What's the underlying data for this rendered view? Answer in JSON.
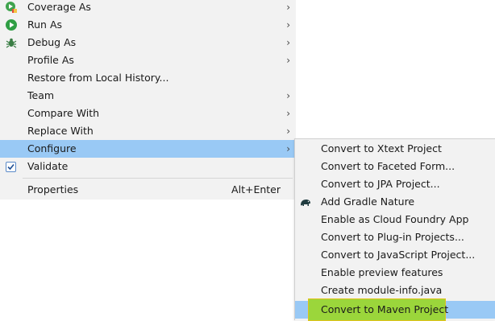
{
  "main_menu": {
    "items": [
      {
        "label": "Coverage As",
        "arrow": "›"
      },
      {
        "label": "Run As",
        "arrow": "›"
      },
      {
        "label": "Debug As",
        "arrow": "›"
      },
      {
        "label": "Profile As",
        "arrow": "›"
      },
      {
        "label": "Restore from Local History..."
      },
      {
        "label": "Team",
        "arrow": "›"
      },
      {
        "label": "Compare With",
        "arrow": "›"
      },
      {
        "label": "Replace With",
        "arrow": "›"
      },
      {
        "label": "Configure",
        "arrow": "›",
        "highlighted": true
      },
      {
        "label": "Validate",
        "checked": true
      },
      {
        "label": "Properties",
        "shortcut": "Alt+Enter"
      }
    ]
  },
  "sub_menu": {
    "items": [
      {
        "label": "Convert to Xtext Project"
      },
      {
        "label": "Convert to Faceted Form..."
      },
      {
        "label": "Convert to JPA Project..."
      },
      {
        "label": "Add Gradle Nature",
        "icon": "gradle-elephant-icon"
      },
      {
        "label": "Enable as Cloud Foundry App"
      },
      {
        "label": "Convert to Plug-in Projects..."
      },
      {
        "label": "Convert to JavaScript Project..."
      },
      {
        "label": "Enable preview features"
      },
      {
        "label": "Create module-info.java"
      },
      {
        "label": "Convert to Maven Project",
        "highlighted": true,
        "focus_box": true
      }
    ]
  },
  "colors": {
    "menu_bg": "#f2f2f2",
    "highlight": "#99c9f5",
    "focus_fill": "#9bd63b",
    "focus_border": "#e2c31a"
  }
}
